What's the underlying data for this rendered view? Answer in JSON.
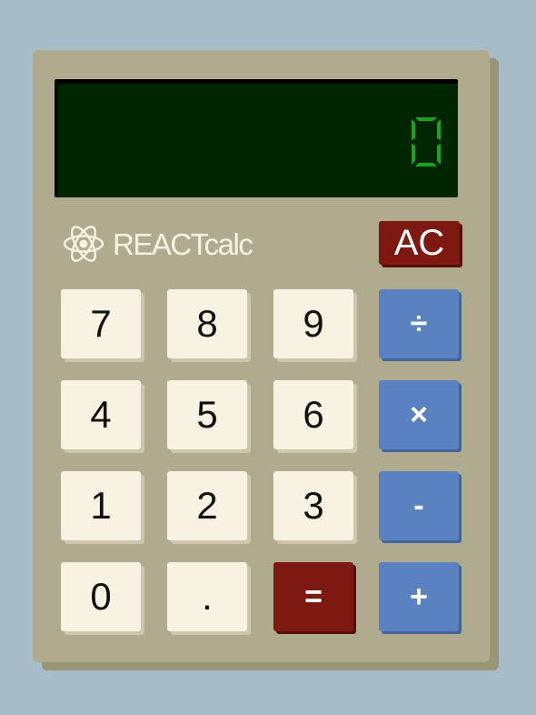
{
  "display": {
    "value": "0",
    "digit_color": "#17a617"
  },
  "brand": {
    "logo_icon": "react-atom-icon",
    "name": "REACTcalc"
  },
  "clear_label": "AC",
  "keys": {
    "row1": [
      "7",
      "8",
      "9",
      "÷"
    ],
    "row2": [
      "4",
      "5",
      "6",
      "×"
    ],
    "row3": [
      "1",
      "2",
      "3",
      "-"
    ],
    "row4": [
      "0",
      ".",
      "=",
      "+"
    ]
  },
  "colors": {
    "background": "#a6bcc6",
    "body": "#b0aa8f",
    "screen": "#002600",
    "number_key": "#f8f2e3",
    "operator_key": "#5b82c0",
    "action_key": "#7e1911"
  }
}
